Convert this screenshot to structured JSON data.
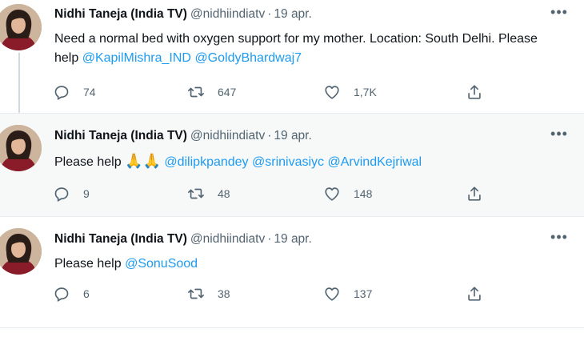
{
  "colors": {
    "link": "#1d9bf0",
    "secondary_text": "#536471",
    "text": "#0f1419",
    "highlight_bg": "#f7f9f9"
  },
  "tweets": [
    {
      "name": "Nidhi Taneja (India TV)",
      "handle": "@nidhiindiatv",
      "separator": "·",
      "date": "19 apr.",
      "text": "Need a normal bed with oxygen support for my mother. Location: South Delhi. Please help",
      "mentions": [
        "@KapilMishra_IND",
        "@GoldyBhardwaj7"
      ],
      "replies": "74",
      "retweets": "647",
      "likes": "1,7K",
      "more_icon": "more-dots-icon"
    },
    {
      "name": "Nidhi Taneja (India TV)",
      "handle": "@nidhiindiatv",
      "separator": "·",
      "date": "19 apr.",
      "text": "Please help",
      "emoji": "🙏🙏",
      "mentions": [
        "@dilipkpandey",
        "@srinivasiyc",
        "@ArvindKejriwal"
      ],
      "replies": "9",
      "retweets": "48",
      "likes": "148",
      "more_icon": "more-dots-icon"
    },
    {
      "name": "Nidhi Taneja (India TV)",
      "handle": "@nidhiindiatv",
      "separator": "·",
      "date": "19 apr.",
      "text": "Please help",
      "mentions": [
        "@SonuSood"
      ],
      "replies": "6",
      "retweets": "38",
      "likes": "137",
      "more_icon": "more-dots-icon"
    }
  ]
}
